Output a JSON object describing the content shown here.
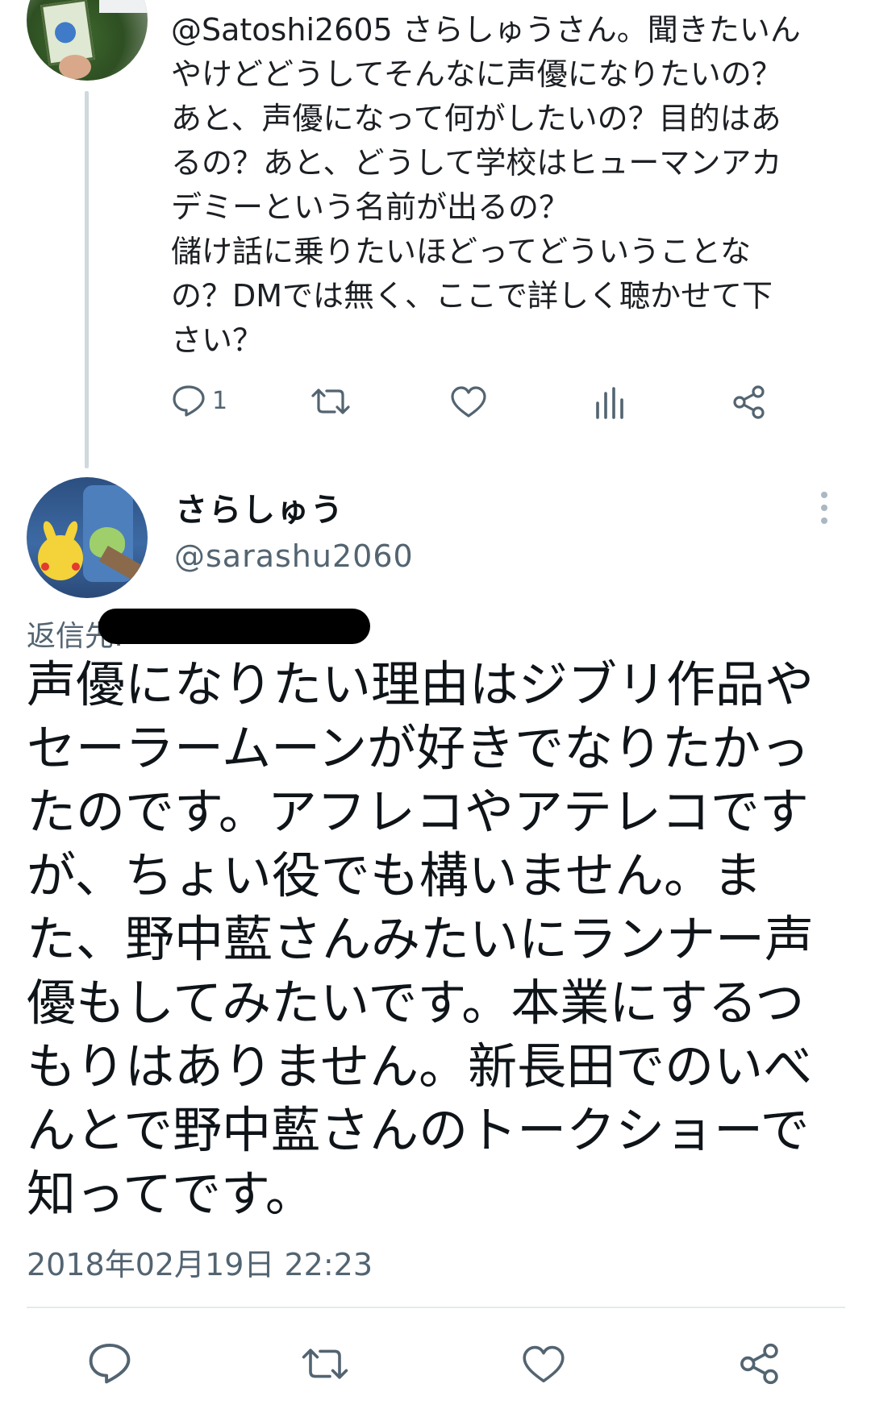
{
  "reply_tweet": {
    "text": "@Satoshi2605 さらしゅうさん。聞きたいん\nやけどどうしてそんなに声優になりたいの？\nあと、声優になって何がしたいの？目的はあ\nるの？あと、どうして学校はヒューマンアカ\nデミーという名前が出るの？\n儲け話に乗りたいほどってどういうことな\nの？DMでは無く、ここで詳しく聴かせて下\nさい？",
    "reply_count": "1"
  },
  "main_tweet": {
    "display_name": "さらしゅう",
    "handle": "@sarashu2060",
    "replying_to_label": "返信先:",
    "text": "声優になりたい理由はジブリ作品や\nセーラームーンが好きでなりたかっ\nたのです。アフレコやアテレコです\nが、ちょい役でも構いません。ま\nた、野中藍さんみたいにランナー声\n優もしてみたいです。本業にするつ\nもりはありません。新長田でのいべ\nんとで野中藍さんのトークショーで\n知ってです。",
    "timestamp": "2018年02月19日 22:23"
  },
  "icons": {
    "reply": "reply-icon",
    "retweet": "retweet-icon",
    "like": "heart-icon",
    "analytics": "analytics-icon",
    "share": "share-icon",
    "more": "more-vertical-icon"
  },
  "colors": {
    "text": "#0f1419",
    "secondary": "#536471",
    "thread_line": "#cfd9de"
  }
}
